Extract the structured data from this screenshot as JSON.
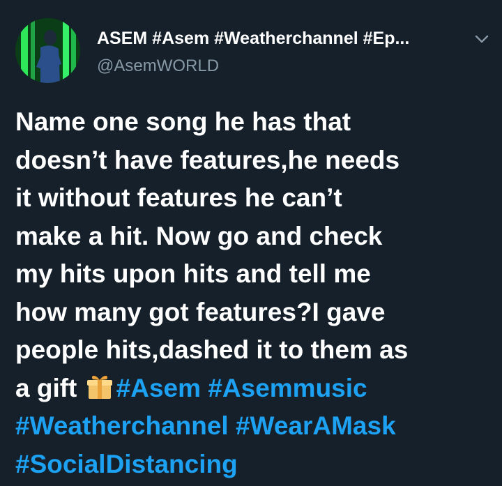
{
  "tweet": {
    "display_name": "ASEM #Asem #Weatherchannel #Ep...",
    "handle": "@AsemWORLD",
    "body_lines": [
      "Name one song he has that",
      "doesn’t have features,he needs",
      "it without features he can’t",
      "make a hit. Now go and check",
      "my hits upon hits and tell me",
      "how many got features?I gave",
      "people hits,dashed it to them as"
    ],
    "last_line_prefix": "a gift ",
    "gift_icon": "gift-icon",
    "hashtags": {
      "asem": "#Asem",
      "asemmusic": "#Asemmusic",
      "weatherchannel": "#Weatherchannel",
      "wearamask": "#WearAMask",
      "socialdistancing": "#SocialDistancing"
    }
  },
  "colors": {
    "background": "#15202b",
    "text": "#ffffff",
    "muted": "#8899a6",
    "link": "#1da1f2"
  }
}
